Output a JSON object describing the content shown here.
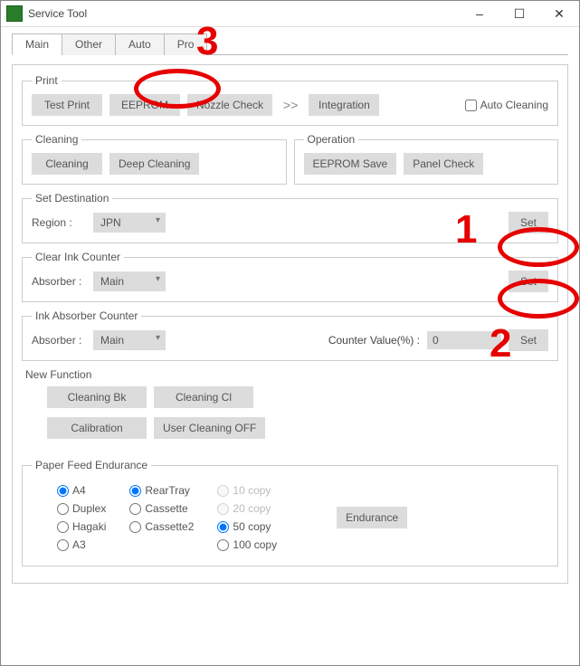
{
  "window": {
    "title": "Service Tool"
  },
  "tabs": {
    "main": "Main",
    "other": "Other",
    "auto": "Auto",
    "pro": "Pro"
  },
  "print": {
    "legend": "Print",
    "test_print": "Test Print",
    "eeprom": "EEPROM",
    "nozzle_check": "Nozzle Check",
    "integration": "Integration",
    "auto_cleaning": "Auto Cleaning"
  },
  "cleaning": {
    "legend": "Cleaning",
    "cleaning": "Cleaning",
    "deep_cleaning": "Deep Cleaning"
  },
  "operation": {
    "legend": "Operation",
    "eeprom_save": "EEPROM Save",
    "panel_check": "Panel Check"
  },
  "set_dest": {
    "legend": "Set Destination",
    "region_label": "Region :",
    "region_value": "JPN",
    "set": "Set"
  },
  "clear_ink": {
    "legend": "Clear Ink Counter",
    "absorber_label": "Absorber :",
    "absorber_value": "Main",
    "set": "Set"
  },
  "ink_abs": {
    "legend": "Ink Absorber Counter",
    "absorber_label": "Absorber :",
    "absorber_value": "Main",
    "counter_label": "Counter Value(%) :",
    "counter_value": "0",
    "set": "Set"
  },
  "new_func": {
    "title": "New Function",
    "cleaning_bk": "Cleaning Bk",
    "cleaning_cl": "Cleaning Cl",
    "calibration": "Calibration",
    "user_clean_off": "User Cleaning OFF"
  },
  "paper_feed": {
    "legend": "Paper Feed Endurance",
    "col1": {
      "a4": "A4",
      "duplex": "Duplex",
      "hagaki": "Hagaki",
      "a3": "A3"
    },
    "col2": {
      "rear": "RearTray",
      "cassette": "Cassette",
      "cassette2": "Cassette2"
    },
    "col3": {
      "c10": "10 copy",
      "c20": "20 copy",
      "c50": "50 copy",
      "c100": "100 copy"
    },
    "endurance": "Endurance"
  },
  "annotations": {
    "n1": "1",
    "n2": "2",
    "n3": "3"
  }
}
